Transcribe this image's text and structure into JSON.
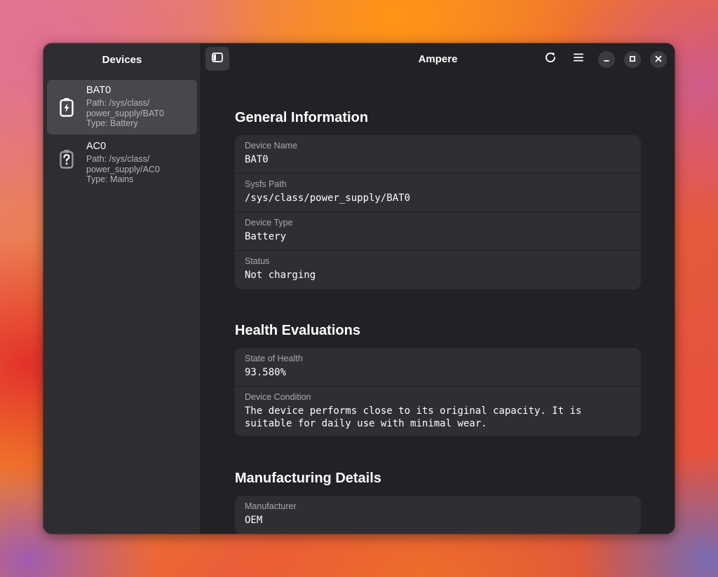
{
  "sidebar": {
    "title": "Devices",
    "devices": [
      {
        "name": "BAT0",
        "path_line1": "Path: /sys/class/",
        "path_line2": "power_supply/BAT0",
        "type": "Type: Battery",
        "icon": "battery-charging-icon",
        "selected": true
      },
      {
        "name": "AC0",
        "path_line1": "Path: /sys/class/",
        "path_line2": "power_supply/AC0",
        "type": "Type: Mains",
        "icon": "battery-unknown-icon",
        "selected": false
      }
    ]
  },
  "header": {
    "title": "Ampere",
    "buttons": [
      "sidebar-toggle-icon",
      "refresh-icon",
      "menu-icon",
      "minimize-icon",
      "maximize-icon",
      "close-icon"
    ]
  },
  "sections": {
    "general": {
      "title": "General Information",
      "rows": [
        {
          "label": "Device Name",
          "value": "BAT0"
        },
        {
          "label": "Sysfs Path",
          "value": "/sys/class/power_supply/BAT0"
        },
        {
          "label": "Device Type",
          "value": "Battery"
        },
        {
          "label": "Status",
          "value": "Not charging"
        }
      ]
    },
    "health": {
      "title": "Health Evaluations",
      "rows": [
        {
          "label": "State of Health",
          "value": "93.580%"
        },
        {
          "label": "Device Condition",
          "value": "The device performs close to its original capacity. It is\nsuitable for daily use with minimal wear."
        }
      ]
    },
    "manufacturing": {
      "title": "Manufacturing Details",
      "rows": [
        {
          "label": "Manufacturer",
          "value": "OEM"
        }
      ]
    }
  },
  "colors": {
    "window_bg": "#222226",
    "sidebar_bg": "#2e2e32",
    "card_bg": "#2f2f33",
    "selected_bg": "#47474c",
    "text_primary": "#ffffff",
    "text_secondary": "#a8a8ad"
  }
}
